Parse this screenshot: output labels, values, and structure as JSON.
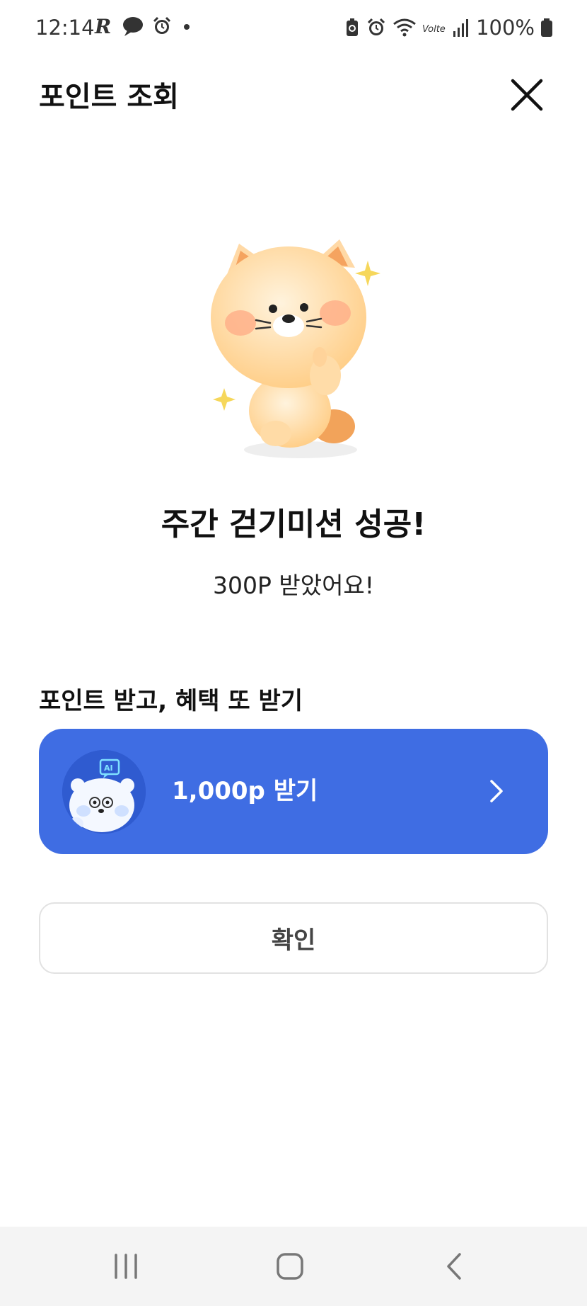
{
  "status_bar": {
    "time": "12:14",
    "battery": "100%",
    "icons_left": [
      "r-app-icon",
      "chat-bubble-icon",
      "alarm-icon",
      "dot-icon"
    ],
    "icons_right": [
      "battery-saver-icon",
      "alarm-icon",
      "wifi-icon",
      "volte-icon",
      "signal-icon",
      "battery-icon"
    ],
    "volte_text": "Volte"
  },
  "header": {
    "title": "포인트 조회",
    "close_icon": "close-icon"
  },
  "result": {
    "headline": "주간 걷기미션 성공!",
    "subline": "300P 받았어요!"
  },
  "benefit": {
    "section_label": "포인트 받고, 혜택 또 받기",
    "promo_label": "1,000p 받기",
    "promo_badge": "AI",
    "promo_color": "#3f6de3"
  },
  "actions": {
    "confirm_label": "확인"
  },
  "nav": {
    "recents_icon": "recents-icon",
    "home_icon": "home-icon",
    "back_icon": "back-icon"
  }
}
